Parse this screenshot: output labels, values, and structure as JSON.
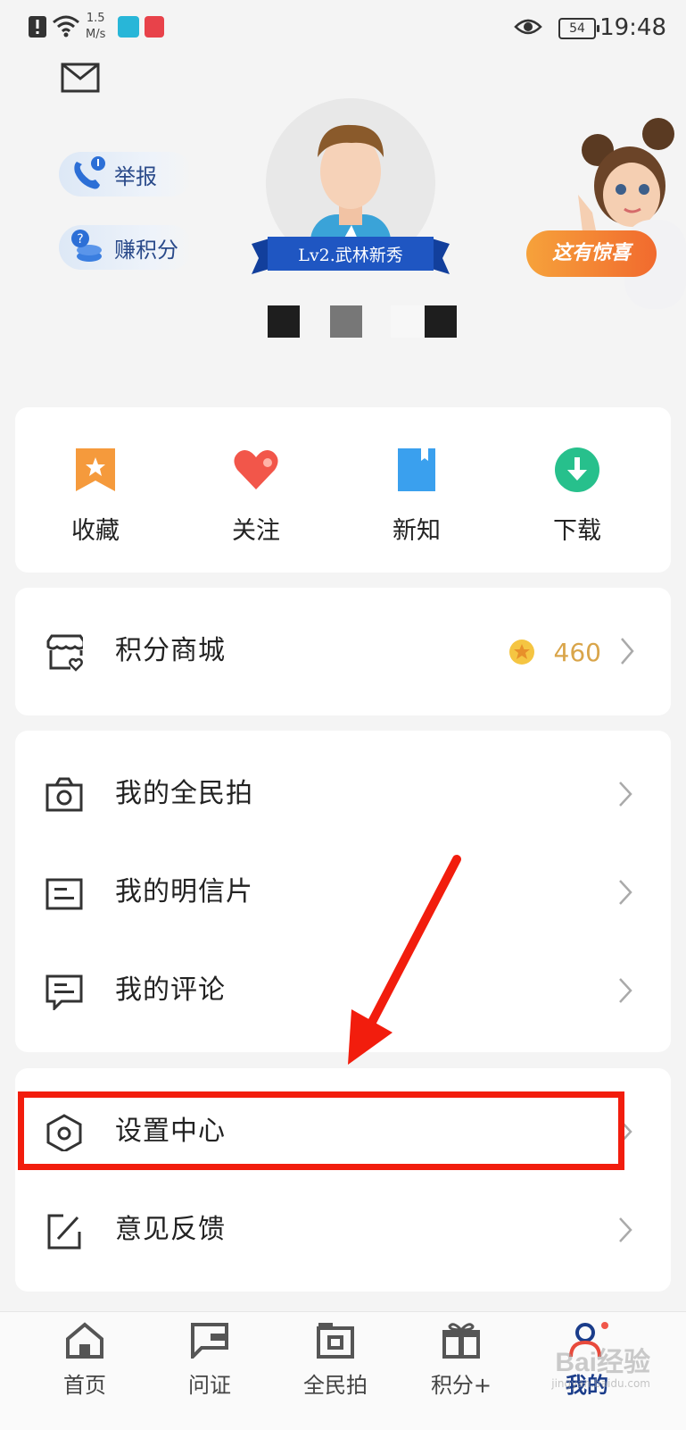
{
  "status_bar": {
    "speed_value": "1.5",
    "speed_unit": "M/s",
    "battery": "54",
    "time": "19:48"
  },
  "header": {
    "report_label": "举报",
    "earn_points_label": "赚积分",
    "level_label": "Lv2.武林新秀",
    "surprise_label": "这有惊喜"
  },
  "quick_actions": [
    {
      "label": "收藏",
      "icon": "bookmark-icon",
      "color": "#f59a3c"
    },
    {
      "label": "关注",
      "icon": "heart-icon",
      "color": "#f2564a"
    },
    {
      "label": "新知",
      "icon": "book-icon",
      "color": "#3aa0ee"
    },
    {
      "label": "下载",
      "icon": "download-icon",
      "color": "#27c08c"
    }
  ],
  "points_mall": {
    "label": "积分商城",
    "points": "460"
  },
  "menu_group_1": [
    {
      "label": "我的全民拍",
      "icon": "camera-icon"
    },
    {
      "label": "我的明信片",
      "icon": "postcard-icon"
    },
    {
      "label": "我的评论",
      "icon": "comment-icon"
    }
  ],
  "menu_group_2": [
    {
      "label": "设置中心",
      "icon": "settings-hexagon-icon"
    },
    {
      "label": "意见反馈",
      "icon": "feedback-edit-icon"
    }
  ],
  "bottom_nav": [
    {
      "label": "首页",
      "icon": "home-icon"
    },
    {
      "label": "问证",
      "icon": "flag-icon"
    },
    {
      "label": "全民拍",
      "icon": "camera-icon"
    },
    {
      "label": "积分+",
      "icon": "gift-icon"
    },
    {
      "label": "我的",
      "icon": "person-icon",
      "active": true
    }
  ],
  "watermark": {
    "brand": "Bai经验",
    "url": "jingyan.baidu.com"
  },
  "colors": {
    "accent_blue": "#1a3c8a",
    "highlight_red": "#f21d0d",
    "points_gold": "#d9a54a"
  }
}
